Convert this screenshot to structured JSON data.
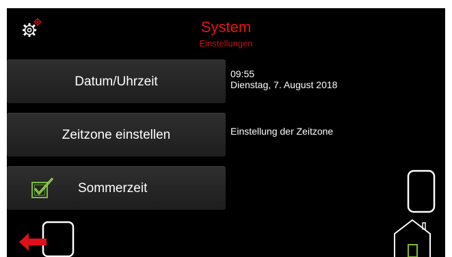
{
  "header": {
    "title": "System",
    "subtitle": "Einstellungen"
  },
  "menu": {
    "datetime_label": "Datum/Uhrzeit",
    "timezone_label": "Zeitzone einstellen",
    "dst_label": "Sommerzeit",
    "dst_checked": true
  },
  "info": {
    "time": "09:55",
    "date": "Dienstag, 7. August 2018",
    "timezone_description": "Einstellung der Zeitzone"
  },
  "icons": {
    "settings": "gear-icon",
    "phone": "phone-icon",
    "logout": "logout-arrow-icon",
    "home": "home-icon"
  },
  "colors": {
    "background": "#000000",
    "title": "#e8121a",
    "accent_red": "#e0101a",
    "checkbox_green": "#7dbb3a"
  }
}
